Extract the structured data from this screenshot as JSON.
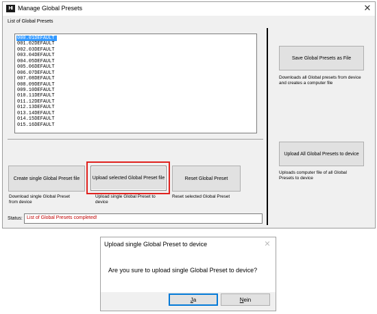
{
  "window": {
    "app_icon": "HI",
    "title": "Manage Global Presets",
    "close_glyph": "✕",
    "list_label": "List of Global Presets",
    "presets": [
      "000.01DEFAULT",
      "001.02DEFAULT",
      "002.03DEFAULT",
      "003.04DEFAULT",
      "004.05DEFAULT",
      "005.06DEFAULT",
      "006.07DEFAULT",
      "007.08DEFAULT",
      "008.09DEFAULT",
      "009.10DEFAULT",
      "010.11DEFAULT",
      "011.12DEFAULT",
      "012.13DEFAULT",
      "013.14DEFAULT",
      "014.15DEFAULT",
      "015.16DEFAULT"
    ],
    "selected_index": 0,
    "buttons": {
      "create_single": "Create single Global Preset file",
      "upload_selected": "Upload selected Global Preset file",
      "reset": "Reset Global Preset",
      "save_all": "Save Global Presets as File",
      "upload_all": "Upload All Global Presets to device"
    },
    "descriptions": {
      "create_single": "Download single Global Preset from device",
      "upload_selected": "Upload single Global Preset to device",
      "reset": "Reset selected Global Preset",
      "save_all": "Downloads all Global presets from device and creates a computer file",
      "upload_all": "Uploads computer file of all Global Presets to device"
    },
    "status_label": "Status:",
    "status_value": "List of Global Presets completed!"
  },
  "dialog": {
    "title": "Upload single Global Preset to device",
    "close_glyph": "✕",
    "message": "Are you sure to upload single Global Preset to device?",
    "yes_key": "J",
    "yes_rest": "a",
    "no_key": "N",
    "no_rest": "ein"
  },
  "colors": {
    "highlight": "#e0201c",
    "selection": "#3399ff",
    "status_text": "#c00000",
    "default_button": "#0078d7"
  }
}
